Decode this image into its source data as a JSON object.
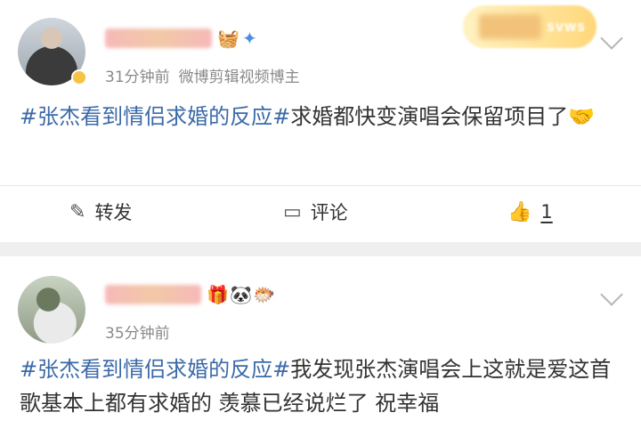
{
  "posts": [
    {
      "time": "31分钟前",
      "source": "微博剪辑视频博主",
      "topic": "#张杰看到情侣求婚的反应#",
      "text": "求婚都快变演唱会保留项目了",
      "emoji_end": "🤝",
      "badge_icons": [
        "basket-emoji",
        "sparkle-emoji"
      ],
      "actions": {
        "repost_label": "转发",
        "comment_label": "评论",
        "like_count": "1"
      },
      "promo_text": "SVWS"
    },
    {
      "time": "35分钟前",
      "topic": "#张杰看到情侣求婚的反应#",
      "text": "我发现张杰演唱会上这就是爱这首歌基本上都有求婚的 羡慕已经说烂了 祝幸福",
      "badge_icons": [
        "gift-emoji",
        "panda-emoji",
        "fish-emoji"
      ]
    }
  ],
  "colors": {
    "topic": "#3b6aa8",
    "meta": "#8a8a8a",
    "background": "#efefef"
  }
}
